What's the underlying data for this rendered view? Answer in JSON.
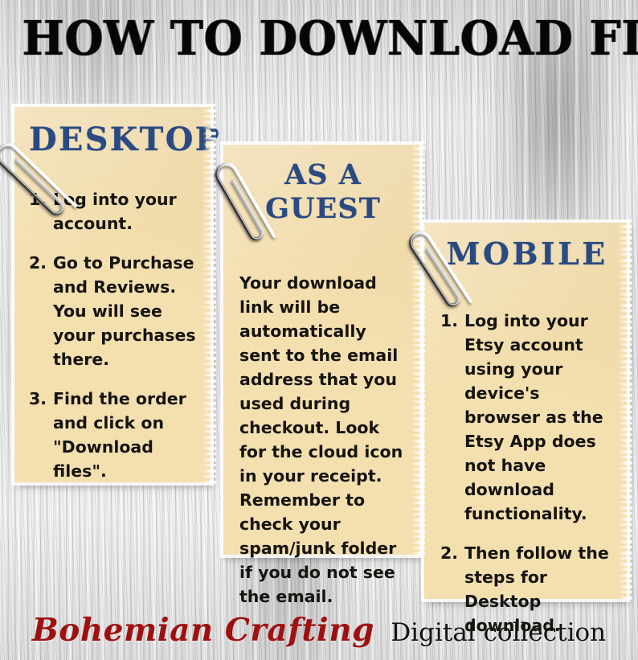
{
  "title": "HOW TO DOWNLOAD FILES",
  "colors": {
    "paper": "#f4dfaf",
    "heading_blue": "#2a4a82",
    "body_text": "#15140f",
    "brand_red": "#9e1010",
    "background_wood": "#e6e6e7"
  },
  "cards": [
    {
      "id": "desktop",
      "heading": "DESKTOP",
      "type": "numbered-list",
      "steps": [
        {
          "num": "1.",
          "text": "Log into your account."
        },
        {
          "num": "2.",
          "text": "Go to Purchase and Reviews. You will see your purchases there."
        },
        {
          "num": "3.",
          "text": "Find the order and click on \"Download files\"."
        }
      ]
    },
    {
      "id": "guest",
      "heading": "AS A GUEST",
      "type": "paragraph",
      "paragraph": "Your download link will be automatically sent to the email address that you used during checkout. Look for the cloud icon in your receipt. Remember to check your spam/junk folder if you do not see the email."
    },
    {
      "id": "mobile",
      "heading": "MOBILE",
      "type": "numbered-list",
      "steps": [
        {
          "num": "1.",
          "text": "Log into your Etsy account using your device's browser as the Etsy App does not have download functionality."
        },
        {
          "num": "2.",
          "text": "Then follow the steps for Desktop download."
        }
      ]
    }
  ],
  "clips": [
    {
      "name": "paperclip-desktop"
    },
    {
      "name": "paperclip-guest"
    },
    {
      "name": "paperclip-mobile"
    }
  ],
  "footer": {
    "brand": "Bohemian Crafting",
    "tagline": "Digital collection"
  }
}
